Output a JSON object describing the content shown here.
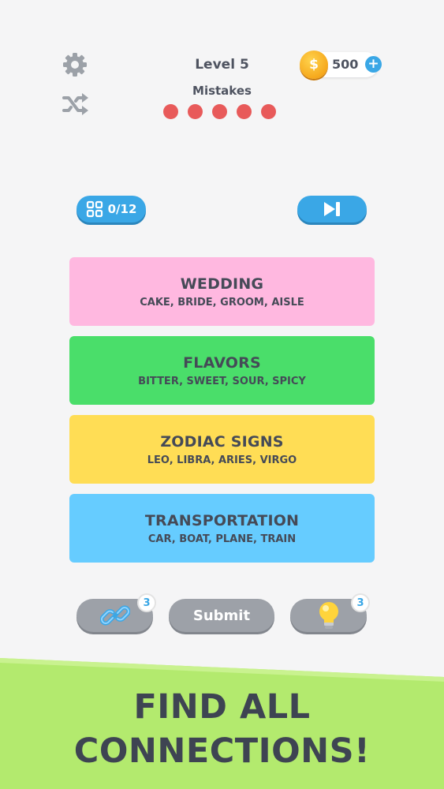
{
  "header": {
    "level_title": "Level 5",
    "mistakes_label": "Mistakes",
    "mistakes_remaining": 5,
    "coins": "500",
    "settings_icon": "gear-icon",
    "shuffle_icon": "shuffle-icon",
    "coin_icon": "coin-icon",
    "add_coins_icon": "plus-icon"
  },
  "toolbar": {
    "progress": "0/12",
    "progress_icon": "grid-icon",
    "skip_icon": "skip-icon"
  },
  "categories": [
    {
      "title": "WEDDING",
      "words": "CAKE, BRIDE, GROOM, AISLE",
      "color": "#ffb8e0"
    },
    {
      "title": "FLAVORS",
      "words": "BITTER, SWEET, SOUR, SPICY",
      "color": "#4ade6a"
    },
    {
      "title": "ZODIAC SIGNS",
      "words": "LEO, LIBRA, ARIES, VIRGO",
      "color": "#ffdd55"
    },
    {
      "title": "TRANSPORTATION",
      "words": "CAR, BOAT, PLANE, TRAIN",
      "color": "#66ccff"
    }
  ],
  "actions": {
    "link_count": "3",
    "submit_label": "Submit",
    "hint_count": "3",
    "link_icon": "link-icon",
    "hint_icon": "lightbulb-icon"
  },
  "banner": {
    "line1": "FIND ALL",
    "line2": "CONNECTIONS!"
  },
  "colors": {
    "accent": "#3aa7e6",
    "mistake_dot": "#e85a5a",
    "banner_green": "#b3ea6e"
  }
}
